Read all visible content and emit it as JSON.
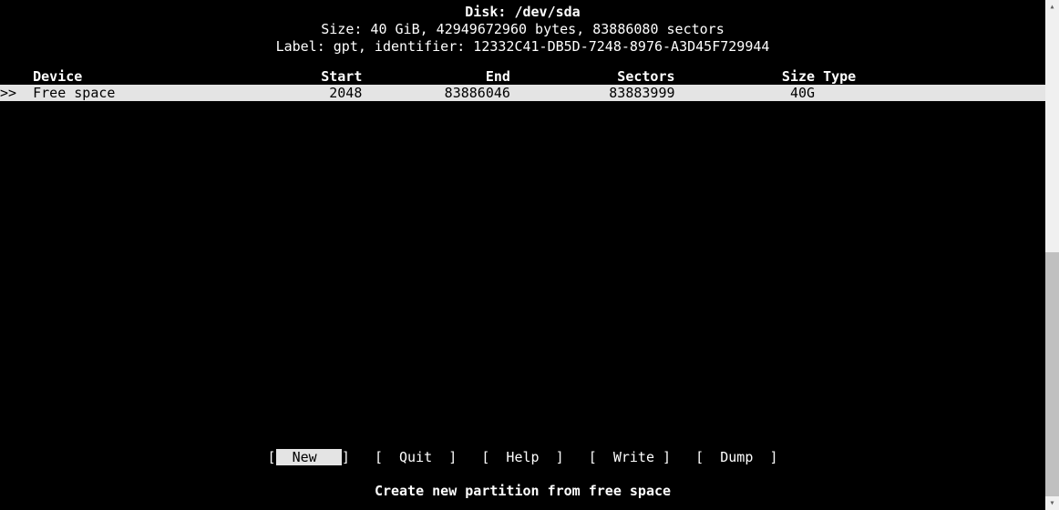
{
  "header": {
    "disk_prefix": "Disk: ",
    "disk_path": "/dev/sda",
    "size_line": "Size: 40 GiB, 42949672960 bytes, 83886080 sectors",
    "label_line": "Label: gpt, identifier: 12332C41-DB5D-7248-8976-A3D45F729944"
  },
  "table": {
    "columns": {
      "device": "Device",
      "start": "Start",
      "end": "End",
      "sectors": "Sectors",
      "size": "Size",
      "type": "Type"
    },
    "rows": [
      {
        "selected": true,
        "device": "Free space",
        "start": "2048",
        "end": "83886046",
        "sectors": "83883999",
        "size": "40G",
        "type": ""
      }
    ]
  },
  "menu": {
    "items": [
      {
        "label": "New",
        "active": true
      },
      {
        "label": "Quit",
        "active": false
      },
      {
        "label": "Help",
        "active": false
      },
      {
        "label": "Write",
        "active": false
      },
      {
        "label": "Dump",
        "active": false
      }
    ]
  },
  "hint": "Create new partition from free space"
}
